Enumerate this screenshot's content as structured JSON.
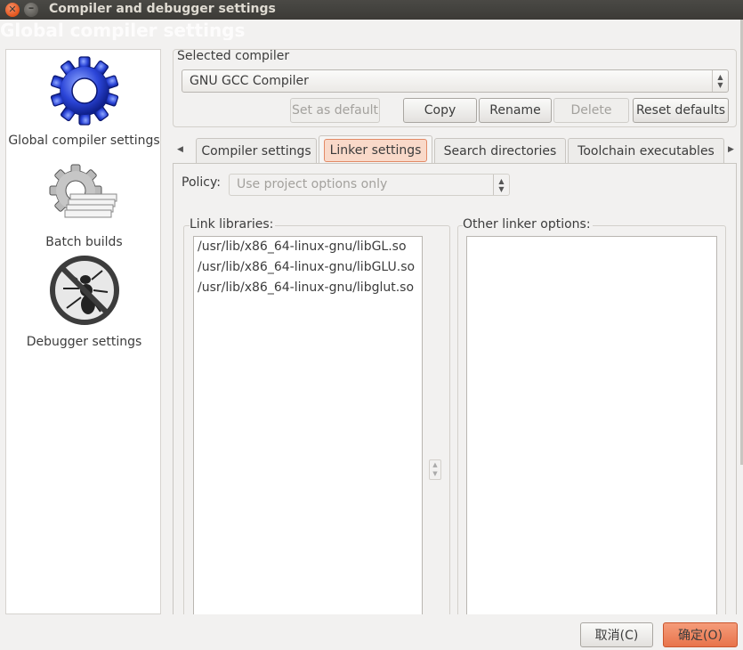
{
  "window": {
    "title": "Compiler and debugger settings",
    "ghost_title": "Global compiler settings"
  },
  "sidebar": {
    "items": [
      {
        "label": "Global compiler settings",
        "icon": "gear-icon",
        "selected": true
      },
      {
        "label": "Batch builds",
        "icon": "batch-builds-icon"
      },
      {
        "label": "Debugger settings",
        "icon": "no-bug-icon"
      }
    ]
  },
  "compiler": {
    "group_label": "Selected compiler",
    "selected": "GNU GCC Compiler",
    "buttons": {
      "set_default": "Set as default",
      "copy": "Copy",
      "rename": "Rename",
      "delete": "Delete",
      "reset": "Reset defaults"
    }
  },
  "tabs": [
    {
      "label": "Compiler settings"
    },
    {
      "label": "Linker settings",
      "active": true
    },
    {
      "label": "Search directories"
    },
    {
      "label": "Toolchain executables"
    }
  ],
  "linker": {
    "policy_label": "Policy:",
    "policy_value": "Use project options only",
    "link_libraries_label": "Link libraries:",
    "link_libraries": [
      "/usr/lib/x86_64-linux-gnu/libGL.so",
      "/usr/lib/x86_64-linux-gnu/libGLU.so",
      "/usr/lib/x86_64-linux-gnu/libglut.so"
    ],
    "other_options_label": "Other linker options:",
    "other_options": ""
  },
  "footer": {
    "cancel": "取消(C)",
    "ok": "确定(O)"
  },
  "colors": {
    "accent": "#e8744b",
    "titlebar": "#3c3b37",
    "selection": "#f9d9c9"
  }
}
